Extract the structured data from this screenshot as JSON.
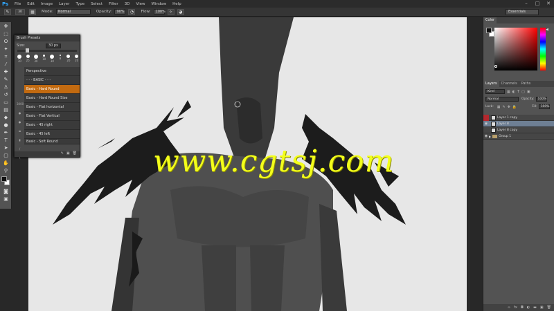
{
  "app": {
    "logo": "Ps"
  },
  "menu": [
    "File",
    "Edit",
    "Image",
    "Layer",
    "Type",
    "Select",
    "Filter",
    "3D",
    "View",
    "Window",
    "Help"
  ],
  "window_controls": {
    "minimize": "–",
    "maximize": "□",
    "close": "✕"
  },
  "options": {
    "brush_size_badge": "30",
    "mode_label": "Mode:",
    "mode_value": "Normal",
    "opacity_label": "Opacity:",
    "opacity_value": "90%",
    "flow_label": "Flow:",
    "flow_value": "100%",
    "workspace": "Essentials"
  },
  "brush_presets": {
    "title": "Brush Presets",
    "size_label": "Size:",
    "size_value": "30 px",
    "tip_sizes": [
      "30",
      "25",
      "30",
      "10",
      "30",
      "8",
      "20",
      "20"
    ],
    "side_label": "3000",
    "items": [
      {
        "label": "Perspective",
        "active": false
      },
      {
        "label": "- - - BASIC - - -",
        "active": false
      },
      {
        "label": "Basic - Hard Round",
        "active": true
      },
      {
        "label": "Basic - Hard Round Size",
        "active": false
      },
      {
        "label": "Basic - Flat horizontal",
        "active": false
      },
      {
        "label": "Basic - Flat Vertical",
        "active": false
      },
      {
        "label": "Basic - 45 right",
        "active": false
      },
      {
        "label": "Basic - 45 left",
        "active": false
      },
      {
        "label": "Basic - Soft Round",
        "active": false
      }
    ]
  },
  "watermark": "www.cgtsj.com",
  "color_panel": {
    "tab": "Color"
  },
  "layers_panel": {
    "tabs": [
      "Layers",
      "Channels",
      "Paths"
    ],
    "filter_value": "Kind",
    "blend_mode": "Normal",
    "opacity_label": "Opacity:",
    "opacity_value": "100%",
    "lock_label": "Lock:",
    "fill_label": "Fill:",
    "fill_value": "100%",
    "layers": [
      {
        "name": "Layer 1 copy",
        "type": "layer",
        "active": false
      },
      {
        "name": "Layer 8",
        "type": "layer",
        "active": true
      },
      {
        "name": "Layer 8 copy",
        "type": "layer",
        "active": false
      },
      {
        "name": "Group 1",
        "type": "group",
        "active": false
      }
    ]
  },
  "colors": {
    "accent_orange": "#c26a10",
    "layer_selected": "#6e7f94",
    "watermark": "#f3ff1b"
  }
}
